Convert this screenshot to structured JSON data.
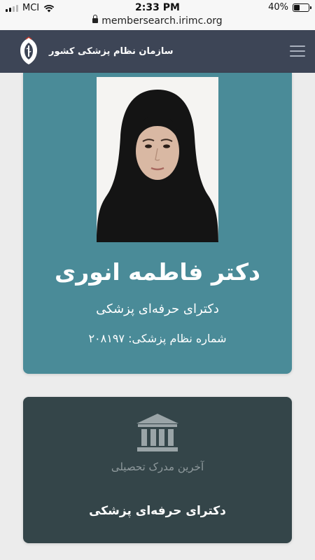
{
  "status_bar": {
    "carrier": "MCI",
    "time": "2:33 PM",
    "battery": "40%",
    "battery_level": 0.4
  },
  "browser": {
    "url": "membersearch.irimc.org"
  },
  "site": {
    "title": "سازمان نظام پزشکی کشور",
    "header_color": "#3d4556"
  },
  "profile": {
    "name": "دکتر فاطمه انوری",
    "degree": "دکترای حرفه‌ای پزشکی",
    "number_text": "شماره نظام پزشکی: ۲۰۸۱۹۷",
    "card_color": "#4a8b98"
  },
  "education": {
    "icon": "institution-icon",
    "label": "آخرین مدرک تحصیلی",
    "value": "دکترای حرفه‌ای پزشکی",
    "card_color": "#344549"
  }
}
